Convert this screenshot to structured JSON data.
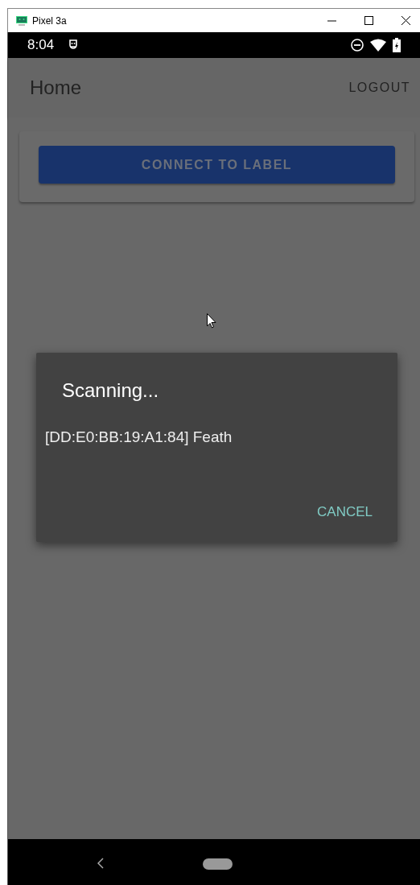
{
  "window": {
    "title": "Pixel 3a"
  },
  "status_bar": {
    "time": "8:04"
  },
  "app_bar": {
    "title": "Home",
    "action": "LOGOUT"
  },
  "card": {
    "button": "CONNECT TO LABEL"
  },
  "dialog": {
    "title": "Scanning...",
    "items": [
      "[DD:E0:BB:19:A1:84] Feath"
    ],
    "button": "CANCEL"
  }
}
